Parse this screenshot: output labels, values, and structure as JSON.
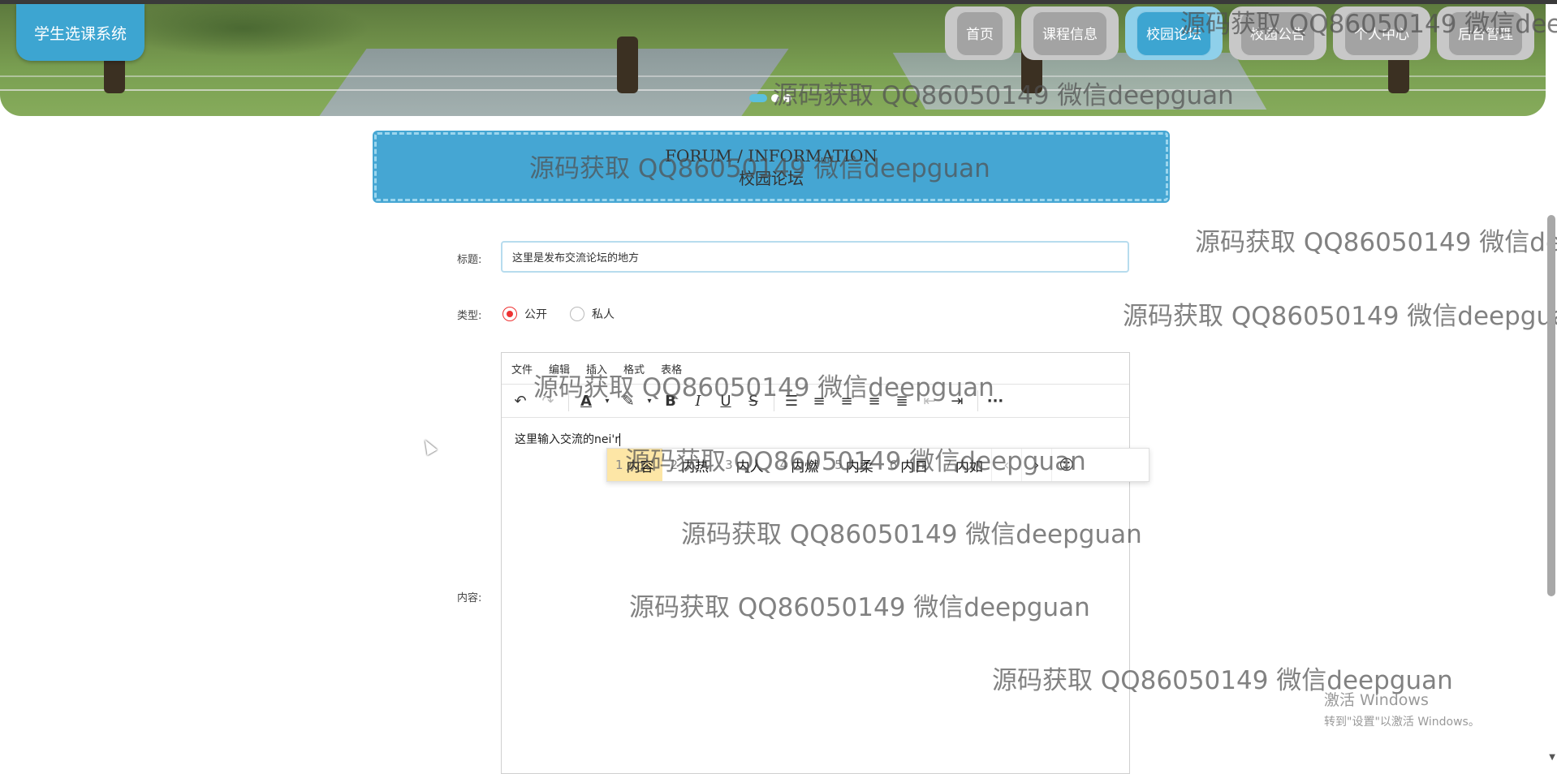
{
  "brand": {
    "title": "学生选课系统"
  },
  "nav": {
    "items": [
      {
        "label": "首页",
        "active": false
      },
      {
        "label": "课程信息",
        "active": false
      },
      {
        "label": "校园论坛",
        "active": true
      },
      {
        "label": "校园公告",
        "active": false
      },
      {
        "label": "个人中心",
        "active": false
      },
      {
        "label": "后台管理",
        "active": false
      }
    ]
  },
  "carousel": {
    "slide_count": 3,
    "active_index": 0
  },
  "section": {
    "title_en": "FORUM / INFORMATION",
    "title_cn": "校园论坛"
  },
  "form": {
    "title_label": "标题:",
    "title_value": "这里是发布交流论坛的地方",
    "type_label": "类型:",
    "type_options": [
      "公开",
      "私人"
    ],
    "type_selected": "公开",
    "content_label": "内容:"
  },
  "editor": {
    "menu": [
      "文件",
      "编辑",
      "插入",
      "格式",
      "表格"
    ],
    "toolbar_icons": [
      "undo-icon",
      "redo-icon",
      "font-color-icon",
      "highlight-icon",
      "bold-icon",
      "italic-icon",
      "underline-icon",
      "strikethrough-icon",
      "bullet-list-icon",
      "align-left-icon",
      "align-center-icon",
      "align-right-icon",
      "align-justify-icon",
      "outdent-icon",
      "indent-icon",
      "more-icon"
    ],
    "content_text": "这里输入交流的nei'r"
  },
  "ime": {
    "candidates": [
      {
        "num": "1",
        "text": "内容"
      },
      {
        "num": "2",
        "text": "内热"
      },
      {
        "num": "3",
        "text": "内人"
      },
      {
        "num": "4",
        "text": "内燃"
      },
      {
        "num": "5",
        "text": "内柔"
      },
      {
        "num": "6",
        "text": "内日"
      },
      {
        "num": "7",
        "text": "内如"
      }
    ],
    "selected_index": 0
  },
  "watermark": {
    "text": "源码获取 QQ86050149 微信deepguan"
  },
  "os_notice": {
    "line1": "激活 Windows",
    "line2": "转到\"设置\"以激活 Windows。"
  }
}
